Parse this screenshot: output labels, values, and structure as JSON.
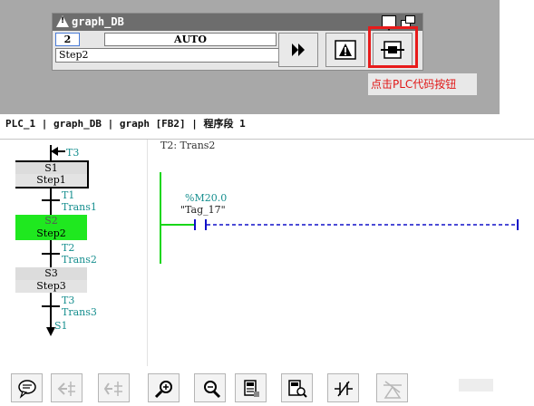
{
  "faceplate": {
    "title": "graph_DB",
    "step_number": "2",
    "mode": "AUTO",
    "step_name": "Step2",
    "buttons": {
      "fast_forward": "fast-forward-icon",
      "alarm": "alarm-warning-icon",
      "plc_code": "plc-code-icon"
    },
    "annotation": "点击PLC代码按钮",
    "highlight_color": "#e81b1b"
  },
  "breadcrumb": "PLC_1 | graph_DB | graph [FB2] | 程序段 1",
  "chain": {
    "transitions": [
      {
        "number": "T3"
      },
      {
        "number": "T1",
        "name": "Trans1"
      },
      {
        "number": "T2",
        "name": "Trans2"
      },
      {
        "number": "T3",
        "name": "Trans3"
      }
    ],
    "steps": [
      {
        "number": "S1",
        "name": "Step1",
        "initial": true,
        "active": false
      },
      {
        "number": "S2",
        "name": "Step2",
        "initial": false,
        "active": true
      },
      {
        "number": "S3",
        "name": "Step3",
        "initial": false,
        "active": false
      }
    ],
    "jump_target": "S1",
    "active_color": "#1fe81f",
    "transition_color": "#178f8f"
  },
  "ladder": {
    "network_label": "T2: Trans2",
    "operand": "%M20.0",
    "tag": "\"Tag_17\"",
    "rail_color": "#19d619",
    "wire_color": "#1010c8"
  },
  "toolbar": {
    "buttons": [
      {
        "icon": "comment-icon",
        "enabled": true
      },
      {
        "icon": "insert-before-icon",
        "enabled": false
      },
      {
        "icon": "insert-after-icon",
        "enabled": false
      },
      {
        "icon": "zoom-in-icon",
        "enabled": true
      },
      {
        "icon": "zoom-out-icon",
        "enabled": true
      },
      {
        "icon": "monitor-icon",
        "enabled": true
      },
      {
        "icon": "monitor-zoom-icon",
        "enabled": true
      },
      {
        "icon": "nc-contact-icon",
        "enabled": true
      },
      {
        "icon": "network-icon",
        "enabled": false
      }
    ]
  }
}
